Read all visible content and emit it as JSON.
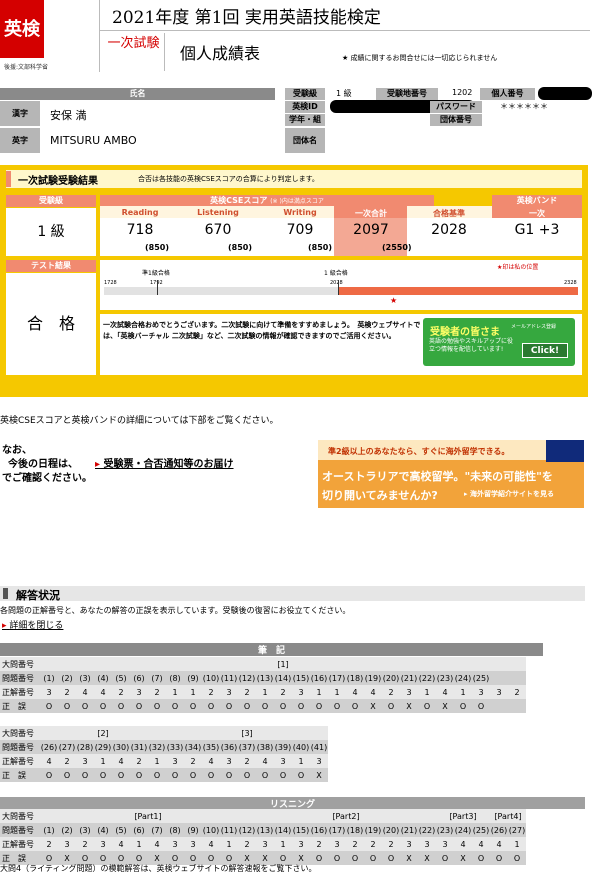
{
  "header": {
    "logo": "英検",
    "logo_caption": "後援:文部科学省",
    "title": "2021年度 第1回 実用英語技能検定",
    "stage": "一次試験",
    "subtitle": "個人成績表",
    "notice": "★ 成績に関するお問合せには一切応じられません"
  },
  "profile": {
    "name_header": "氏名",
    "kanji_label": "漢字",
    "kanji_name": "安保 満",
    "roman_label": "英字",
    "roman_name": "MITSURU AMBO",
    "grade_label": "受験級",
    "grade_value": "1 級",
    "site_label": "受験地番号",
    "site_value": "1202",
    "personal_label": "個人番号",
    "id_label": "英検ID",
    "password_label": "パスワード",
    "password_value": "＊＊＊＊＊＊",
    "class_label": "学年・組",
    "group_no_label": "団体番号",
    "group_label": "団体名"
  },
  "result": {
    "heading": "一次試験受験結果",
    "heading_note": "合否は各技能の英検CSEスコアの合算により判定します。",
    "grade_label": "受験級",
    "grade_value": "1 級",
    "cse_header": "英検CSEスコア",
    "cse_note": "(※ )内は満点スコア",
    "band_header": "英検バンド",
    "columns": [
      "Reading",
      "Listening",
      "Writing",
      "一次合計",
      "合格基準",
      "一次"
    ],
    "scores": [
      "718",
      "670",
      "709",
      "2097",
      "2028",
      "G1 +3"
    ],
    "maxes": [
      "(850)",
      "(850)",
      "(850)",
      "(2550)"
    ],
    "test_label": "テスト結果",
    "test_value": "合　格",
    "scale_left_label": "準1級合格",
    "scale_right_label": "1 級合格",
    "scale_marker_note": "★印は私の位置",
    "scale_ticks": [
      "1728",
      "1792",
      "2028",
      "2328"
    ],
    "message": "一次試験合格おめでとうございます。二次試験に向けて準備をすすめましょう。　英検ウェブサイトでは、「英検バーチャル 二次試験」など、二次試験の情報が確認できますのでご活用ください。",
    "banner_title": "受験者の皆さま",
    "banner_text": "英語の勉強やスキルアップに役立つ情報を配信しています!",
    "banner_btn": "Click!",
    "banner_tag": "メールアドレス登録"
  },
  "info": {
    "detail_line": "英検CSEスコアと英検バンドの詳細については下部をご覧ください。",
    "schedule_1": "なお、",
    "schedule_2": "今後の日程は、",
    "schedule_link": "受験票・合否通知等のお届け",
    "schedule_3": "でご確認ください。",
    "ad_line1": "準2級以上のあなたなら、すぐに海外留学できる。",
    "ad_line2": "オーストラリアで高校留学。\"未来の可能性\"を",
    "ad_line3": "切り開いてみませんか?",
    "ad_button": "海外留学紹介サイトを見る"
  },
  "answers": {
    "heading": "解答状況",
    "desc": "各問題の正解番号と、あなたの解答の正誤を表示しています。受験後の復習にお役立てください。",
    "close_link": "詳細を閉じる",
    "written_header": "筆　記",
    "listening_header": "リスニング",
    "row_labels": [
      "大問番号",
      "問題番号",
      "正解番号",
      "正　誤"
    ],
    "t1": {
      "section": "[1]",
      "nums": [
        "(1)",
        "(2)",
        "(3)",
        "(4)",
        "(5)",
        "(6)",
        "(7)",
        "(8)",
        "(9)",
        "(10)",
        "(11)",
        "(12)",
        "(13)",
        "(14)",
        "(15)",
        "(16)",
        "(17)",
        "(18)",
        "(19)",
        "(20)",
        "(21)",
        "(22)",
        "(23)",
        "(24)",
        "(25)"
      ],
      "correct": [
        "3",
        "2",
        "4",
        "4",
        "2",
        "3",
        "2",
        "1",
        "1",
        "2",
        "3",
        "2",
        "1",
        "2",
        "3",
        "1",
        "1",
        "4",
        "4",
        "2",
        "3",
        "1",
        "4",
        "1",
        "3",
        "3",
        "2"
      ],
      "marks": [
        "O",
        "O",
        "O",
        "O",
        "O",
        "O",
        "O",
        "O",
        "O",
        "O",
        "O",
        "O",
        "O",
        "O",
        "O",
        "O",
        "O",
        "O",
        "X",
        "O",
        "X",
        "O",
        "X",
        "O",
        "O"
      ]
    },
    "t2": {
      "sec_a": "[2]",
      "sec_b": "[3]",
      "nums": [
        "(26)",
        "(27)",
        "(28)",
        "(29)",
        "(30)",
        "(31)",
        "(32)",
        "(33)",
        "(34)",
        "(35)",
        "(36)",
        "(37)",
        "(38)",
        "(39)",
        "(40)",
        "(41)"
      ],
      "correct": [
        "4",
        "2",
        "3",
        "1",
        "4",
        "2",
        "1",
        "3",
        "2",
        "4",
        "3",
        "2",
        "4",
        "3",
        "1",
        "3"
      ],
      "marks": [
        "O",
        "O",
        "O",
        "O",
        "O",
        "O",
        "O",
        "O",
        "O",
        "O",
        "O",
        "O",
        "O",
        "O",
        "O",
        "X"
      ]
    },
    "t3": {
      "parts": [
        "[Part1]",
        "[Part2]",
        "[Part3]",
        "[Part4]"
      ],
      "nums": [
        "(1)",
        "(2)",
        "(3)",
        "(4)",
        "(5)",
        "(6)",
        "(7)",
        "(8)",
        "(9)",
        "(10)",
        "(11)",
        "(12)",
        "(13)",
        "(14)",
        "(15)",
        "(16)",
        "(17)",
        "(18)",
        "(19)",
        "(20)",
        "(21)",
        "(22)",
        "(23)",
        "(24)",
        "(25)",
        "(26)",
        "(27)"
      ],
      "correct": [
        "2",
        "3",
        "2",
        "3",
        "4",
        "1",
        "4",
        "3",
        "3",
        "4",
        "1",
        "2",
        "3",
        "1",
        "3",
        "2",
        "3",
        "2",
        "2",
        "2",
        "3",
        "3",
        "3",
        "4",
        "4",
        "4",
        "1"
      ],
      "marks": [
        "O",
        "X",
        "O",
        "O",
        "O",
        "O",
        "X",
        "O",
        "O",
        "O",
        "O",
        "X",
        "X",
        "O",
        "X",
        "O",
        "O",
        "O",
        "O",
        "O",
        "X",
        "X",
        "O",
        "X",
        "O",
        "O",
        "O"
      ]
    },
    "footer": "大問4（ライティング問題）の模範解答は、英検ウェブサイトの解答速報をご覧下さい。"
  }
}
